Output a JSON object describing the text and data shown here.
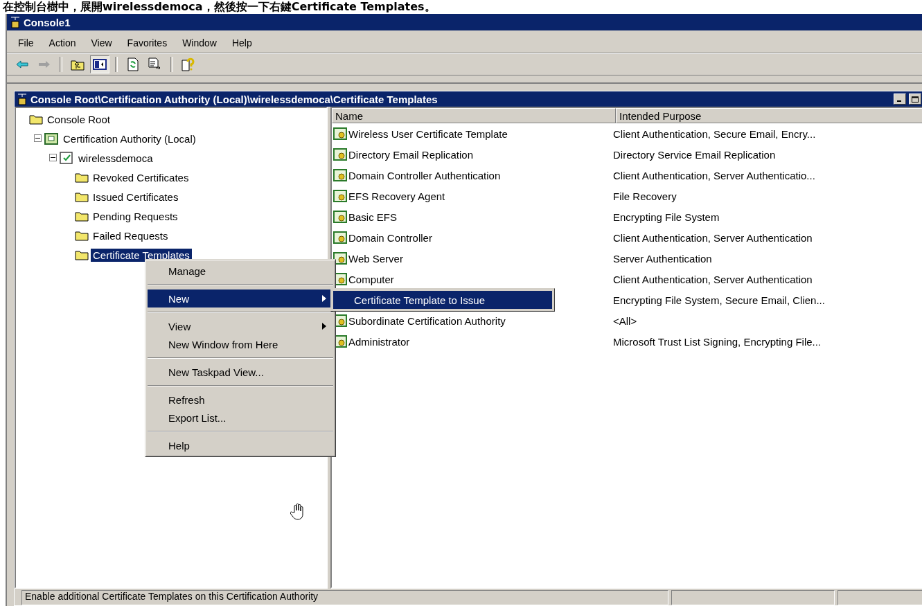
{
  "caption": "在控制台樹中，展開wirelessdemoca，然後按一下右鍵Certificate Templates。",
  "window": {
    "title": "Console1"
  },
  "menu": [
    {
      "label": "File"
    },
    {
      "label": "Action"
    },
    {
      "label": "View"
    },
    {
      "label": "Favorites"
    },
    {
      "label": "Window"
    },
    {
      "label": "Help"
    }
  ],
  "toolbar": [
    {
      "kind": "back"
    },
    {
      "kind": "forward"
    },
    {
      "kind": "sep"
    },
    {
      "kind": "up"
    },
    {
      "kind": "tree",
      "pressed": true
    },
    {
      "kind": "sep"
    },
    {
      "kind": "refresh"
    },
    {
      "kind": "export"
    },
    {
      "kind": "sep"
    },
    {
      "kind": "help"
    }
  ],
  "child_window": {
    "title": "Console Root\\Certification Authority (Local)\\wirelessdemoca\\Certificate Templates"
  },
  "tree": [
    {
      "label": "Console Root",
      "kind": "folder",
      "selected": false,
      "children": [
        {
          "label": "Certification Authority (Local)",
          "kind": "ca",
          "selected": false,
          "expanded": true,
          "children": [
            {
              "label": "wirelessdemoca",
              "kind": "server",
              "selected": false,
              "expanded": true,
              "children": [
                {
                  "label": "Revoked Certificates",
                  "kind": "folder",
                  "selected": false
                },
                {
                  "label": "Issued Certificates",
                  "kind": "folder",
                  "selected": false
                },
                {
                  "label": "Pending Requests",
                  "kind": "folder",
                  "selected": false
                },
                {
                  "label": "Failed Requests",
                  "kind": "folder",
                  "selected": false
                },
                {
                  "label": "Certificate Templates",
                  "kind": "folder",
                  "selected": true
                }
              ]
            }
          ]
        }
      ]
    }
  ],
  "list": {
    "columns": [
      "Name",
      "Intended Purpose"
    ],
    "rows": [
      {
        "name": "Wireless User Certificate Template",
        "purpose": "Client Authentication, Secure Email, Encry..."
      },
      {
        "name": "Directory Email Replication",
        "purpose": "Directory Service Email Replication"
      },
      {
        "name": "Domain Controller Authentication",
        "purpose": "Client Authentication, Server Authenticatio..."
      },
      {
        "name": "EFS Recovery Agent",
        "purpose": "File Recovery"
      },
      {
        "name": "Basic EFS",
        "purpose": "Encrypting File System"
      },
      {
        "name": "Domain Controller",
        "purpose": "Client Authentication, Server Authentication"
      },
      {
        "name": "Web Server",
        "purpose": "Server Authentication"
      },
      {
        "name": "Computer",
        "purpose": "Client Authentication, Server Authentication"
      },
      {
        "purpose": "Encrypting File System, Secure Email, Clien..."
      },
      {
        "name": "Subordinate Certification Authority",
        "purpose": "<All>"
      },
      {
        "name": "Administrator",
        "purpose": "Microsoft Trust List Signing, Encrypting File..."
      }
    ]
  },
  "context_menu": {
    "items": [
      {
        "kind": "item",
        "label": "Manage",
        "selected": false,
        "submenu": false
      },
      {
        "kind": "separator"
      },
      {
        "kind": "item",
        "label": "New",
        "selected": true,
        "submenu": true
      },
      {
        "kind": "separator"
      },
      {
        "kind": "item",
        "label": "View",
        "selected": false,
        "submenu": true
      },
      {
        "kind": "item",
        "label": "New Window from Here",
        "selected": false,
        "submenu": false
      },
      {
        "kind": "separator"
      },
      {
        "kind": "item",
        "label": "New Taskpad View...",
        "selected": false,
        "submenu": false
      },
      {
        "kind": "separator"
      },
      {
        "kind": "item",
        "label": "Refresh",
        "selected": false,
        "submenu": false
      },
      {
        "kind": "item",
        "label": "Export List...",
        "selected": false,
        "submenu": false
      },
      {
        "kind": "separator"
      },
      {
        "kind": "item",
        "label": "Help",
        "selected": false,
        "submenu": false
      }
    ]
  },
  "submenu": {
    "items": [
      {
        "label": "Certificate Template to Issue",
        "selected": true
      }
    ]
  },
  "status_bar": {
    "text": "Enable additional Certificate Templates on this Certification Authority"
  }
}
